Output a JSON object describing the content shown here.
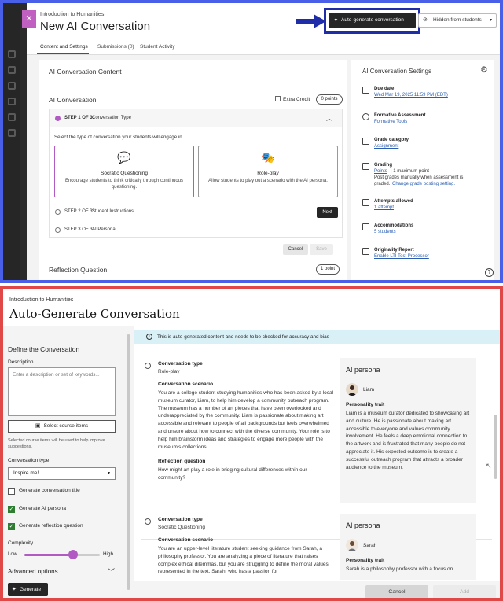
{
  "top": {
    "breadcrumb": "Introduction to Humanities",
    "title": "New AI Conversation",
    "auto_generate_label": "Auto-generate conversation",
    "hidden_label": "Hidden from students",
    "tabs": [
      "Content and Settings",
      "Submissions (0)",
      "Student Activity"
    ],
    "content_title": "AI Conversation Content",
    "ai_conversation_title": "AI Conversation",
    "extra_credit_label": "Extra Credit",
    "points_label": "0 points",
    "step1_label": "STEP 1 OF 3:",
    "step1_name": "Conversation Type",
    "select_type_prompt": "Select the type of conversation your students will engage in.",
    "socratic": {
      "name": "Socratic Questioning",
      "desc": "Encourage students to think critically through continuous questioning."
    },
    "roleplay": {
      "name": "Role-play",
      "desc": "Allow students to play out a scenario with the AI persona."
    },
    "step2_label": "STEP 2 OF 3:",
    "step2_name": "Student Instructions",
    "next_label": "Next",
    "step3_label": "STEP 3 OF 3:",
    "step3_name": "AI Persona",
    "cancel_label": "Cancel",
    "save_label": "Save",
    "reflection_title": "Reflection Question",
    "reflection_points": "1 point"
  },
  "settings": {
    "title": "AI Conversation Settings",
    "due_date": {
      "label": "Due date",
      "value": "Wed Mar 19, 2025 11:59 PM (EDT)"
    },
    "formative": {
      "label": "Formative Assessment",
      "value": "Formative Tools"
    },
    "grade_category": {
      "label": "Grade category",
      "value": "Assignment"
    },
    "grading": {
      "label": "Grading",
      "value": "Points",
      "value_suffix": "| 1 maximum point",
      "line2": "Post grades manually when assessment is",
      "line3_text": "graded.",
      "line3_link": "Change grade posting setting."
    },
    "attempts": {
      "label": "Attempts allowed",
      "value": "1 attempt"
    },
    "accommodations": {
      "label": "Accommodations",
      "value": "5 students"
    },
    "originality": {
      "label": "Originality Report",
      "value": "Enable LTI Test Processor"
    }
  },
  "bottom": {
    "breadcrumb": "Introduction to Humanities",
    "title": "Auto-Generate Conversation",
    "define_title": "Define the Conversation",
    "description_label": "Description",
    "description_placeholder": "Enter a description or set of keywords...",
    "select_course_label": "Select course items",
    "course_hint": "Selected course items will be used to help improve suggestions.",
    "conv_type_label": "Conversation type",
    "conv_type_value": "Inspire me!",
    "checkboxes": [
      {
        "label": "Generate conversation title",
        "checked": false
      },
      {
        "label": "Generate AI persona",
        "checked": true
      },
      {
        "label": "Generate reflection question",
        "checked": true
      }
    ],
    "complexity_label": "Complexity",
    "complexity_low": "Low",
    "complexity_high": "High",
    "complexity_level": 0.65,
    "advanced_label": "Advanced options",
    "generate_label": "Generate",
    "banner": "This is auto-generated content and needs to be checked for accuracy and bias",
    "results": [
      {
        "type_label": "Conversation type",
        "type_value": "Role-play",
        "scenario_label": "Conversation scenario",
        "scenario": "You are a college student studying humanities who has been asked by a local museum curator, Liam, to help him develop a community outreach program. The museum has a number of art pieces that have been overlooked and underappreciated by the community. Liam is passionate about making art accessible and relevant to people of all backgrounds but feels overwhelmed and unsure about how to connect with the diverse community. Your role is to help him brainstorm ideas and strategies to engage more people with the museum's collections.",
        "reflection_label": "Reflection question",
        "reflection": "How might art play a role in bridging cultural differences within our community?",
        "persona_heading": "AI persona",
        "persona_name": "Liam",
        "trait_label": "Personality trait",
        "trait": "Liam is a museum curator dedicated to showcasing art and culture. He is passionate about making art accessible to everyone and values community involvement. He feels a deep emotional connection to the artwork and is frustrated that many people do not appreciate it. His expected outcome is to create a successful outreach program that attracts a broader audience to the museum."
      },
      {
        "type_label": "Conversation type",
        "type_value": "Socratic Questioning",
        "scenario_label": "Conversation scenario",
        "scenario": "You are an upper-level literature student seeking guidance from Sarah, a philosophy professor. You are analyzing a piece of literature that raises complex ethical dilemmas, but you are struggling to define the moral values represented in the text. Sarah, who has a passion for",
        "persona_heading": "AI persona",
        "persona_name": "Sarah",
        "trait_label": "Personality trait",
        "trait": "Sarah is a philosophy professor with a focus on"
      }
    ],
    "cancel_label": "Cancel",
    "add_label": "Add"
  },
  "colors": {
    "accent": "#b25ac4",
    "top_border": "#4a5fe8",
    "bottom_border": "#e04848",
    "highlight_frame": "#1f2ea8",
    "link": "#2a5db0",
    "banner": "#d8f0f6"
  },
  "icons": [
    "close-icon",
    "arrow-right-icon",
    "sparkle-icon",
    "eye-slash-icon",
    "chevron-up-icon",
    "chat-question-icon",
    "theater-masks-icon",
    "gear-icon",
    "calendar-icon",
    "star-icon",
    "grade-icon",
    "grading-icon",
    "attempts-icon",
    "accommodations-icon",
    "originality-icon",
    "help-icon",
    "info-icon",
    "radio-icon",
    "avatar-icon"
  ]
}
